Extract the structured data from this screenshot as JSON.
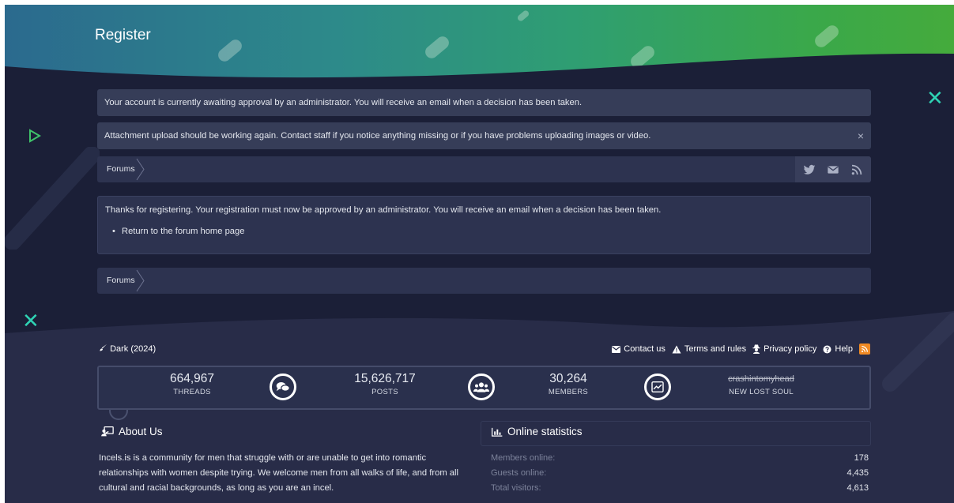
{
  "header": {
    "title": "Register"
  },
  "notices": [
    {
      "text": "Your account is currently awaiting approval by an administrator. You will receive an email when a decision has been taken."
    },
    {
      "text": "Attachment upload should be working again. Contact staff if you notice anything missing or if you have problems uploading images or video.",
      "dismiss": "×"
    }
  ],
  "breadcrumb": {
    "label": "Forums"
  },
  "share_icons": [
    "twitter-icon",
    "mail-icon",
    "rss-icon"
  ],
  "content": {
    "message": "Thanks for registering. Your registration must now be approved by an administrator. You will receive an email when a decision has been taken.",
    "link": "Return to the forum home page"
  },
  "footer": {
    "style_label": "Dark (2024)",
    "links": {
      "contact": "Contact us",
      "terms": "Terms and rules",
      "privacy": "Privacy policy",
      "help": "Help"
    }
  },
  "stats": {
    "threads": {
      "value": "664,967",
      "label": "THREADS"
    },
    "posts": {
      "value": "15,626,717",
      "label": "POSTS"
    },
    "members": {
      "value": "30,264",
      "label": "MEMBERS"
    },
    "latest": {
      "value": "crashintomyhead",
      "label": "NEW LOST SOUL"
    }
  },
  "about": {
    "title": "About Us",
    "text": "Incels.is is a community for men that struggle with or are unable to get into romantic relationships with women despite trying. We welcome men from all walks of life, and from all cultural and racial backgrounds, as long as you are an incel."
  },
  "online": {
    "title": "Online statistics",
    "rows": [
      {
        "label": "Members online:",
        "value": "178"
      },
      {
        "label": "Guests online:",
        "value": "4,435"
      },
      {
        "label": "Total visitors:",
        "value": "4,613"
      }
    ]
  },
  "colors": {
    "background": "#1b1f37",
    "panel": "#2d3350",
    "notice": "#363d58",
    "accent_teal": "#2fd3b4",
    "header_left": "#2b6a8e",
    "header_right": "#45ab3c",
    "rss": "#f08a24"
  }
}
